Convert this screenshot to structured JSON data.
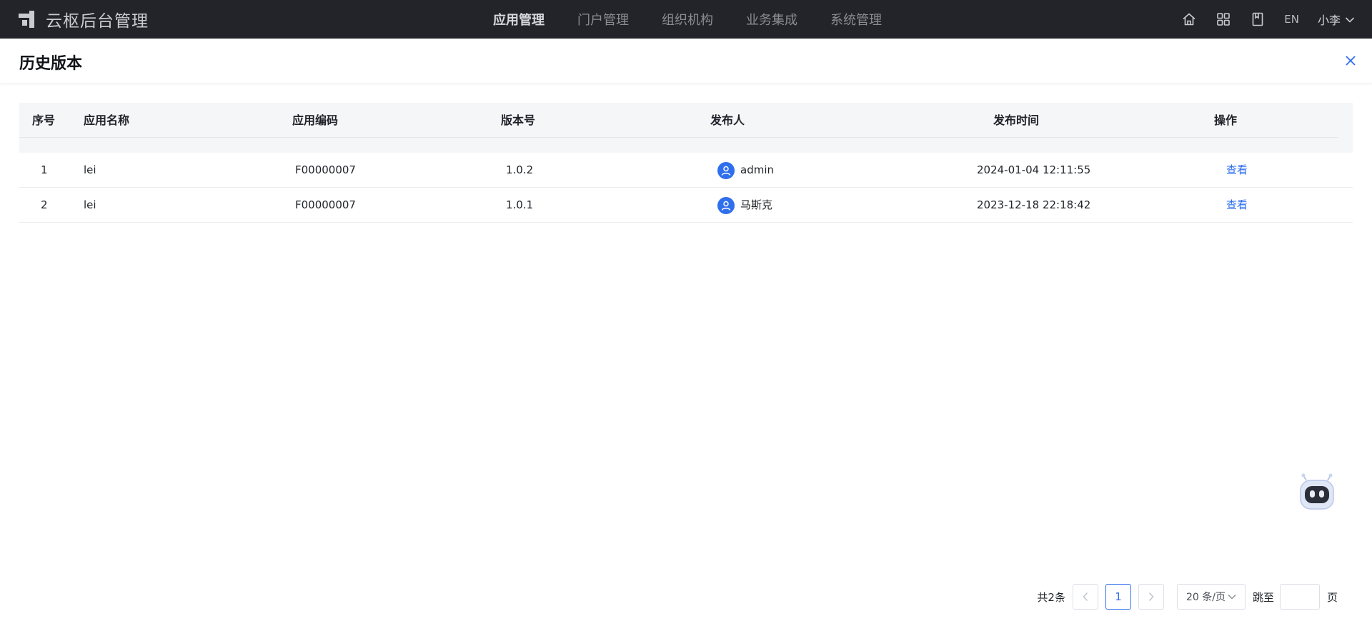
{
  "app": {
    "title": "云枢后台管理"
  },
  "nav": {
    "items": [
      {
        "label": "应用管理",
        "active": true
      },
      {
        "label": "门户管理",
        "active": false
      },
      {
        "label": "组织机构",
        "active": false
      },
      {
        "label": "业务集成",
        "active": false
      },
      {
        "label": "系统管理",
        "active": false
      }
    ]
  },
  "toolbar": {
    "icons": [
      "home-icon",
      "apps-grid-icon",
      "book-icon"
    ],
    "lang": "EN",
    "user": "小李"
  },
  "page": {
    "title": "历史版本"
  },
  "table": {
    "columns": [
      "序号",
      "应用名称",
      "应用编码",
      "版本号",
      "发布人",
      "发布时间",
      "操作"
    ],
    "rows": [
      {
        "index": "1",
        "name": "lei",
        "code": "F00000007",
        "version": "1.0.2",
        "publisher": "admin",
        "time": "2024-01-04 12:11:55",
        "action": "查看"
      },
      {
        "index": "2",
        "name": "lei",
        "code": "F00000007",
        "version": "1.0.1",
        "publisher": "马斯克",
        "time": "2023-12-18 22:18:42",
        "action": "查看"
      }
    ]
  },
  "pagination": {
    "total": "共2条",
    "current_page": "1",
    "page_size": "20 条/页",
    "jump_label": "跳至",
    "page_suffix": "页",
    "jump_value": ""
  },
  "colors": {
    "accent": "#2f6fed",
    "topbar": "#232429"
  }
}
